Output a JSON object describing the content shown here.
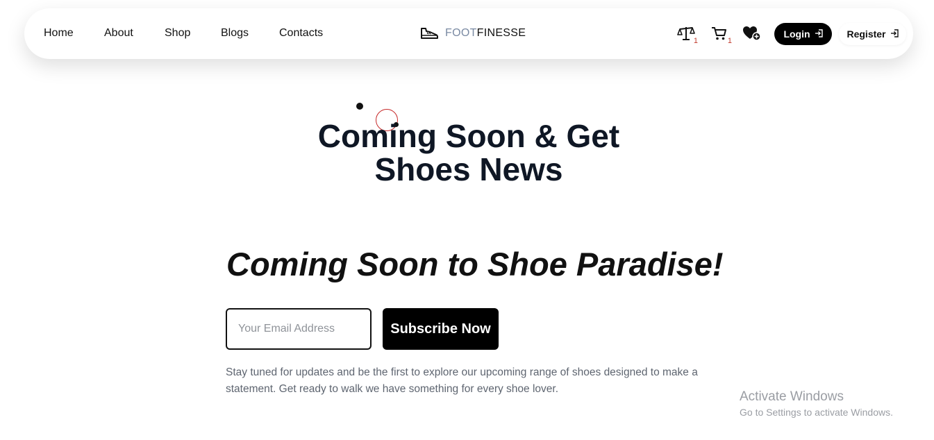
{
  "nav": {
    "links": [
      "Home",
      "About",
      "Shop",
      "Blogs",
      "Contacts"
    ],
    "brand": {
      "light": "FOOT",
      "dark": "FINESSE",
      "icon": "sneaker-icon"
    },
    "compare": {
      "icon": "balance-scale-icon",
      "count": "1"
    },
    "cart": {
      "icon": "cart-icon",
      "count": "1"
    },
    "wishlist": {
      "icon": "heart-plus-icon"
    },
    "login_label": "Login",
    "register_label": "Register"
  },
  "hero": {
    "title_line1": "Coming Soon & Get",
    "title_line2": "Shoes News"
  },
  "promo": {
    "title": "Coming Soon to Shoe Paradise!",
    "email_placeholder": "Your Email Address",
    "email_value": "",
    "subscribe_label": "Subscribe Now",
    "description": "Stay tuned for updates and be the first to explore our upcoming range of shoes designed to make a statement. Get ready to walk we have something for every shoe lover."
  },
  "watermark": {
    "title": "Activate Windows",
    "subtitle": "Go to Settings to activate Windows."
  },
  "colors": {
    "accent": "#000000",
    "brand_light": "#7a8aa3",
    "badge": "#c0392b",
    "ring": "#c62828"
  }
}
